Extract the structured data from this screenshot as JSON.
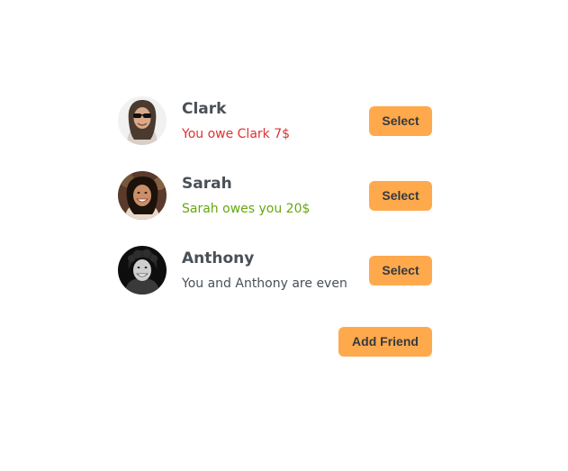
{
  "friends": [
    {
      "name": "Clark",
      "status": "You owe Clark 7$",
      "status_color": "#e03131",
      "select_label": "Select"
    },
    {
      "name": "Sarah",
      "status": "Sarah owes you 20$",
      "status_color": "#66a80f",
      "select_label": "Select"
    },
    {
      "name": "Anthony",
      "status": "You and Anthony are even",
      "status_color": "#495057",
      "select_label": "Select"
    }
  ],
  "add_friend_label": "Add Friend",
  "colors": {
    "button": "#ffa94d",
    "button_text": "#343a40",
    "name_text": "#495057"
  }
}
